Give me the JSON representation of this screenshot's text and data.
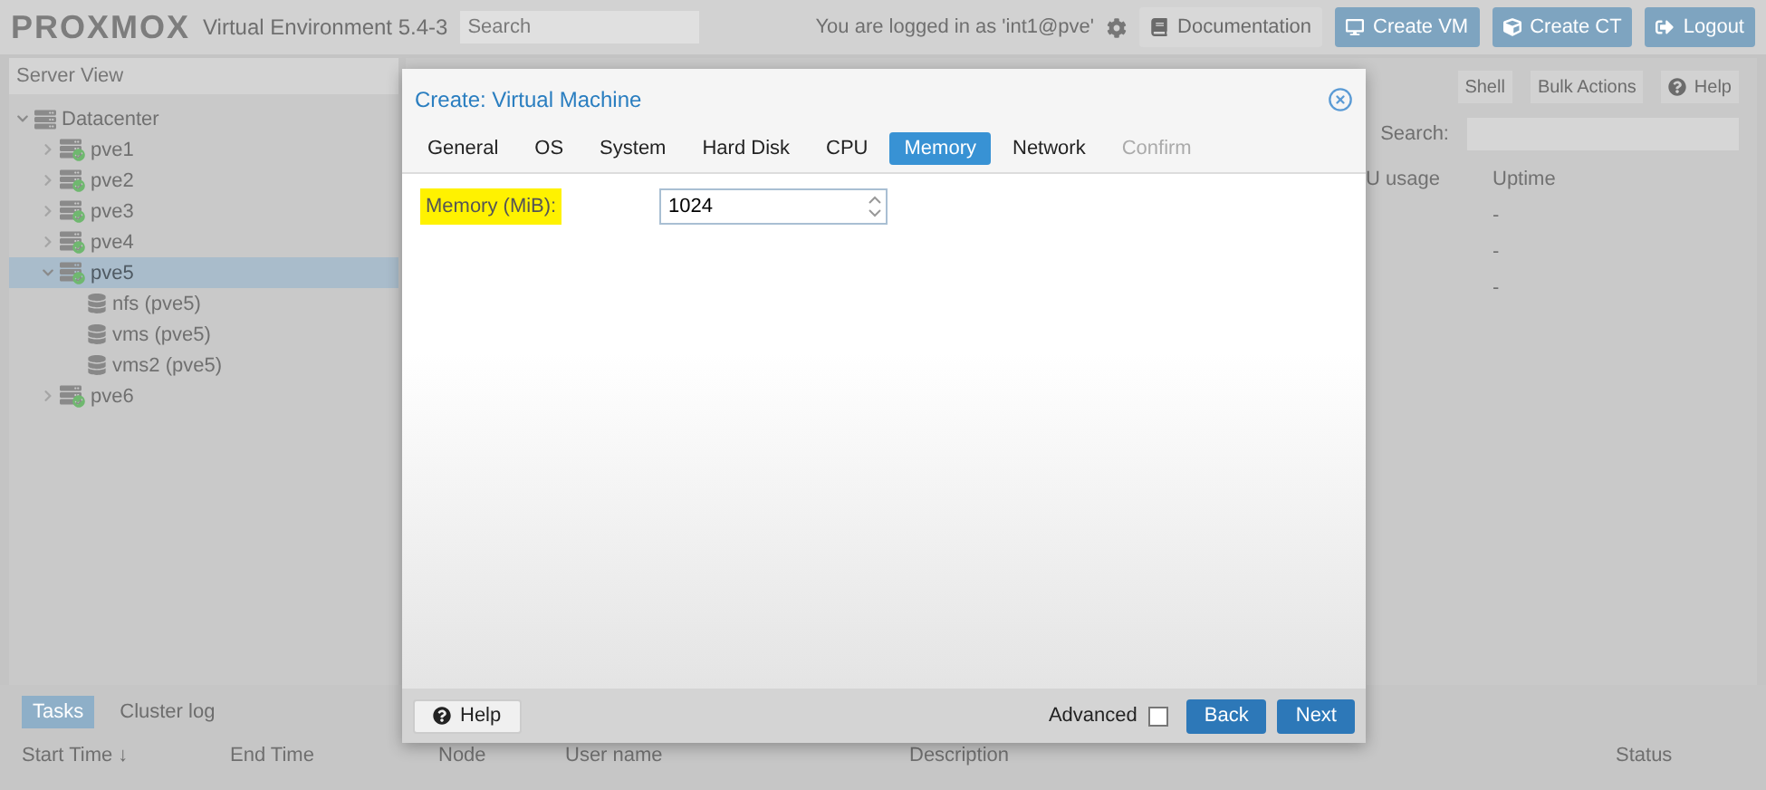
{
  "header": {
    "logo": "PROXMOX",
    "product": "Virtual Environment 5.4-3",
    "search": {
      "placeholder": "Search"
    },
    "login_text": "You are logged in as 'int1@pve'",
    "buttons": [
      {
        "label": "Documentation",
        "kind": "plain"
      },
      {
        "label": "Create VM",
        "kind": "primary"
      },
      {
        "label": "Create CT",
        "kind": "primary"
      },
      {
        "label": "Logout",
        "kind": "primary"
      }
    ]
  },
  "sidebar": {
    "view": "Server View",
    "tree": [
      {
        "label": "Datacenter",
        "kind": "datacenter",
        "selected": false,
        "expanded": true,
        "children": [
          {
            "label": "pve1",
            "kind": "node",
            "selected": false,
            "expanded": false
          },
          {
            "label": "pve2",
            "kind": "node",
            "selected": false,
            "expanded": false
          },
          {
            "label": "pve3",
            "kind": "node",
            "selected": false,
            "expanded": false
          },
          {
            "label": "pve4",
            "kind": "node",
            "selected": false,
            "expanded": false
          },
          {
            "label": "pve5",
            "kind": "node",
            "selected": true,
            "expanded": true,
            "children": [
              {
                "label": "nfs (pve5)",
                "kind": "storage",
                "selected": false
              },
              {
                "label": "vms (pve5)",
                "kind": "storage",
                "selected": false
              },
              {
                "label": "vms2 (pve5)",
                "kind": "storage",
                "selected": false
              }
            ]
          },
          {
            "label": "pve6",
            "kind": "node",
            "selected": false,
            "expanded": false
          }
        ]
      }
    ]
  },
  "content": {
    "toolbar": [
      "Shell",
      "Bulk Actions"
    ],
    "help": "Help",
    "search_label": "Search:",
    "columns": [
      "U usage",
      "Uptime"
    ],
    "rows": [
      [
        "",
        "-"
      ],
      [
        "",
        "-"
      ],
      [
        "",
        "-"
      ]
    ]
  },
  "tasks": {
    "tabs": [
      {
        "label": "Tasks",
        "selected": true
      },
      {
        "label": "Cluster log",
        "selected": false
      }
    ],
    "columns": [
      "Start Time ↓",
      "End Time",
      "Node",
      "User name",
      "Description",
      "Status"
    ]
  },
  "dialog": {
    "title": "Create: Virtual Machine",
    "tabs": [
      {
        "label": "General",
        "selected": false,
        "disabled": false
      },
      {
        "label": "OS",
        "selected": false,
        "disabled": false
      },
      {
        "label": "System",
        "selected": false,
        "disabled": false
      },
      {
        "label": "Hard Disk",
        "selected": false,
        "disabled": false
      },
      {
        "label": "CPU",
        "selected": false,
        "disabled": false
      },
      {
        "label": "Memory",
        "selected": true,
        "disabled": false
      },
      {
        "label": "Network",
        "selected": false,
        "disabled": false
      },
      {
        "label": "Confirm",
        "selected": false,
        "disabled": true
      }
    ],
    "field": {
      "label": "Memory (MiB):",
      "highlighted": true,
      "value": "1024"
    },
    "help": "Help",
    "advanced": {
      "label": "Advanced",
      "checked": false
    },
    "back": "Back",
    "next": "Next"
  }
}
